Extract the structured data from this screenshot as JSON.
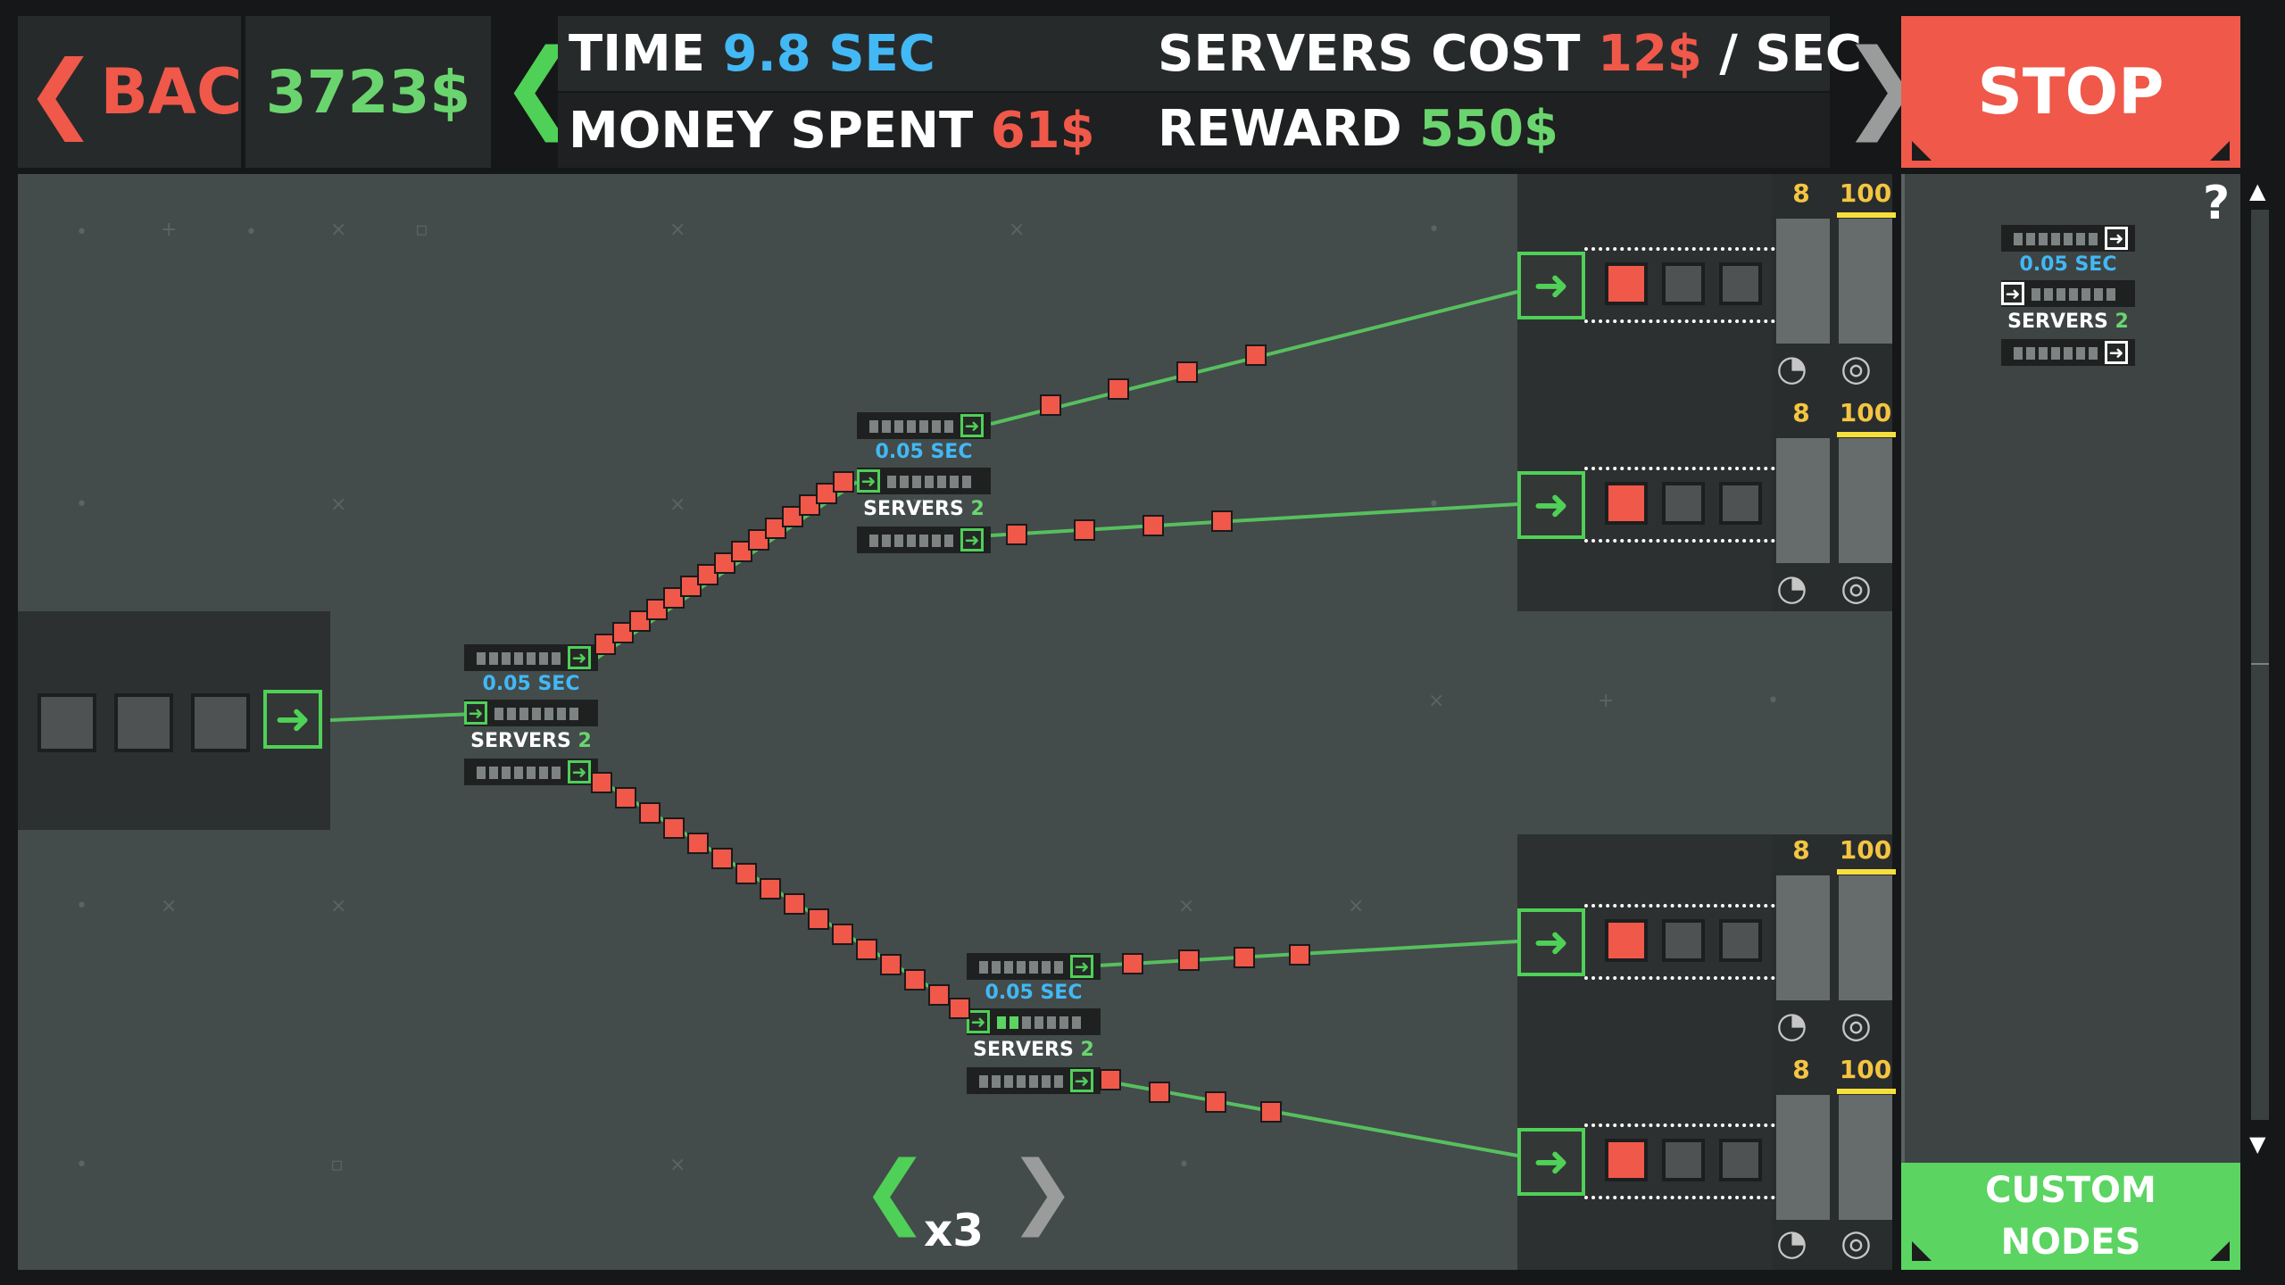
{
  "header": {
    "back_label": "BACK",
    "money": "3723$",
    "time_label": "TIME",
    "time_value": "9.8 SEC",
    "servers_cost_label": "SERVERS COST",
    "servers_cost_value": "12$",
    "servers_cost_unit": "/ SEC",
    "money_spent_label": "MONEY SPENT",
    "money_spent_value": "61$",
    "reward_label": "REWARD",
    "reward_value": "550$",
    "stop_label": "STOP"
  },
  "routers": [
    {
      "sec": "0.05 SEC",
      "servers_label": "SERVERS",
      "servers_count": "2"
    },
    {
      "sec": "0.05 SEC",
      "servers_label": "SERVERS",
      "servers_count": "2"
    },
    {
      "sec": "0.05 SEC",
      "servers_label": "SERVERS",
      "servers_count": "2"
    }
  ],
  "sinks": [
    {
      "left_value": "8",
      "right_value": "100"
    },
    {
      "left_value": "8",
      "right_value": "100"
    },
    {
      "left_value": "8",
      "right_value": "100"
    },
    {
      "left_value": "8",
      "right_value": "100"
    }
  ],
  "speed": {
    "label": "x3"
  },
  "side_panel": {
    "help": "?",
    "palette_router": {
      "sec": "0.05 SEC",
      "servers_label": "SERVERS",
      "servers_count": "2"
    },
    "custom_nodes_line1": "CUSTOM",
    "custom_nodes_line2": "NODES"
  },
  "colors": {
    "accent_red": "#f0584a",
    "accent_green": "#5bd462",
    "accent_blue": "#42b8f5",
    "accent_yellow": "#f4c542",
    "board": "#434b4b"
  }
}
